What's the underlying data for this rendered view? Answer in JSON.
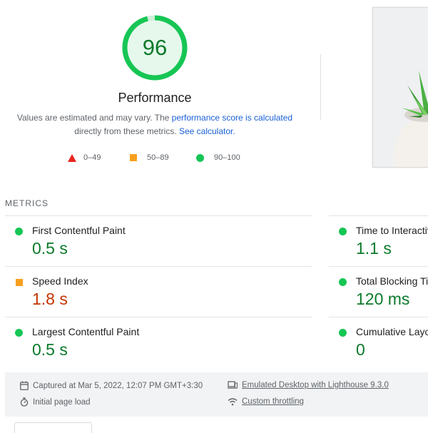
{
  "performance": {
    "score": "96",
    "score_fraction": 0.96,
    "score_color": "#16c654",
    "title": "Performance",
    "desc_prefix": "Values are estimated and may vary. The ",
    "desc_link": "performance score is calculated",
    "desc_middle": "directly from these metrics. ",
    "desc_link2": "See calculator."
  },
  "legend": [
    {
      "label": "0–49",
      "shape": "triangle",
      "color": "#e8251e"
    },
    {
      "label": "50–89",
      "shape": "square",
      "color": "#f79f1e"
    },
    {
      "label": "90–100",
      "shape": "circle",
      "color": "#16c654"
    }
  ],
  "metrics_header": "METRICS",
  "metrics": [
    {
      "name": "First Contentful Paint",
      "value": "0.5 s",
      "status": "pass"
    },
    {
      "name": "Speed Index",
      "value": "1.8 s",
      "status": "average"
    },
    {
      "name": "Largest Contentful Paint",
      "value": "0.5 s",
      "status": "pass"
    },
    {
      "name": "Time to Interactive",
      "value": "1.1 s",
      "status": "pass"
    },
    {
      "name": "Total Blocking Time",
      "value": "120 ms",
      "status": "pass"
    },
    {
      "name": "Cumulative Layout Shift",
      "value": "0",
      "status": "pass"
    }
  ],
  "footer": {
    "captured": "Captured at Mar 5, 2022, 12:07 PM GMT+3:30",
    "page_load": "Initial page load",
    "emulated": "Emulated Desktop with Lighthouse 9.3.0",
    "throttling": "Custom throttling"
  },
  "icons": {
    "calendar": "calendar-icon",
    "timer": "stopwatch-icon",
    "device": "desktop-laptop-icon",
    "network": "wifi-signal-icon"
  }
}
